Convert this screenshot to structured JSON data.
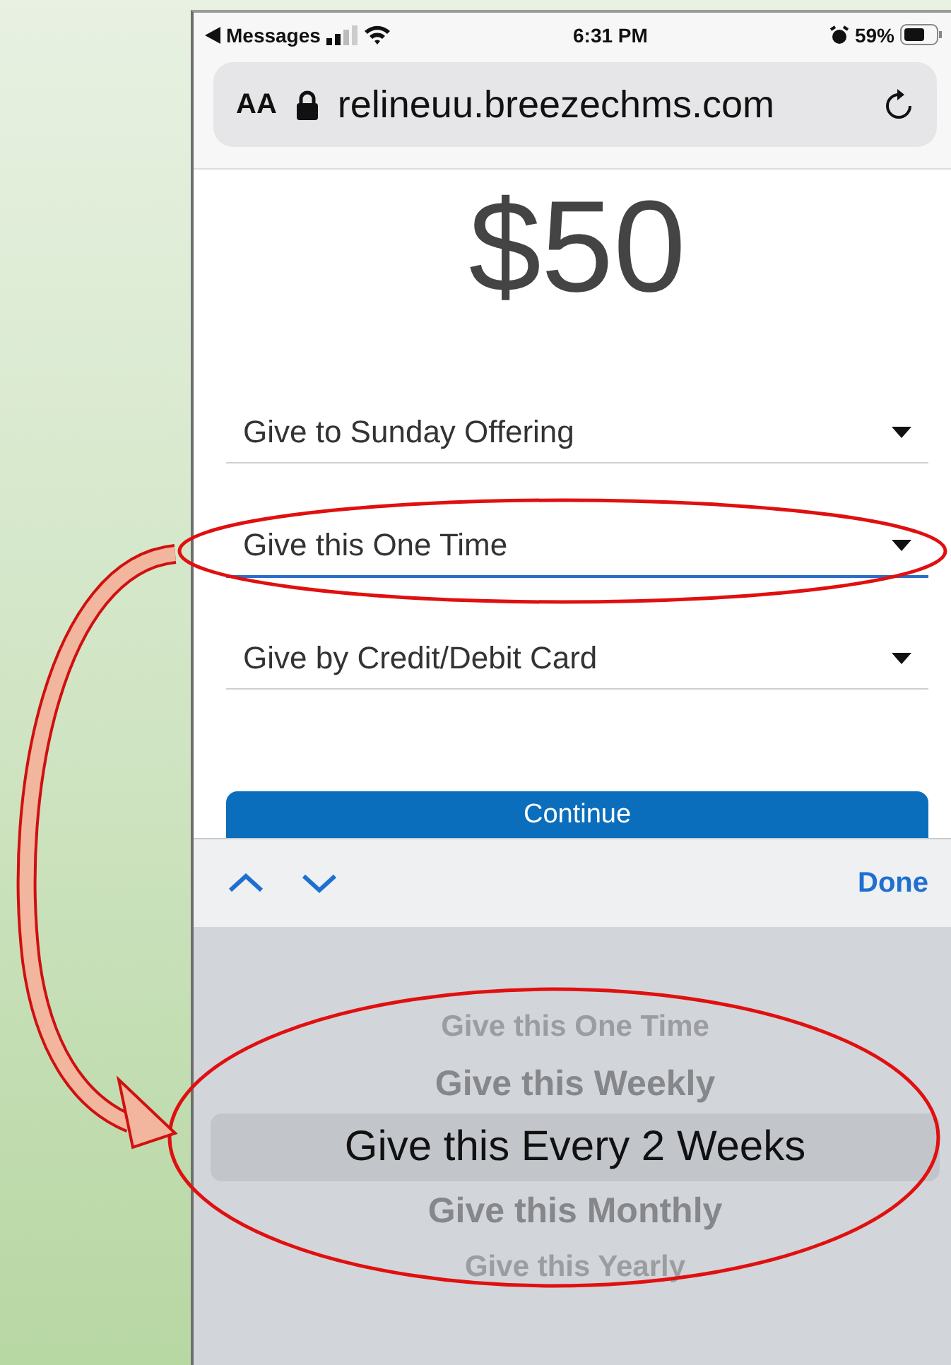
{
  "status_bar": {
    "back_label": "Messages",
    "time": "6:31 PM",
    "battery": "59%"
  },
  "address_bar": {
    "text_size": "AA",
    "url": "relineuu.breezechms.com"
  },
  "amount": "$50",
  "selects": [
    {
      "label": "Give to Sunday Offering",
      "focused": false
    },
    {
      "label": "Give this One Time",
      "focused": true
    },
    {
      "label": "Give by Credit/Debit Card",
      "focused": false
    }
  ],
  "continue_button": "Continue",
  "toolbar": {
    "done": "Done"
  },
  "picker": [
    {
      "label": "Give this One Time",
      "selected": false
    },
    {
      "label": "Give this Weekly",
      "selected": false
    },
    {
      "label": "Give this Every 2 Weeks",
      "selected": true
    },
    {
      "label": "Give this Monthly",
      "selected": false
    },
    {
      "label": "Give this Yearly",
      "selected": false
    }
  ]
}
